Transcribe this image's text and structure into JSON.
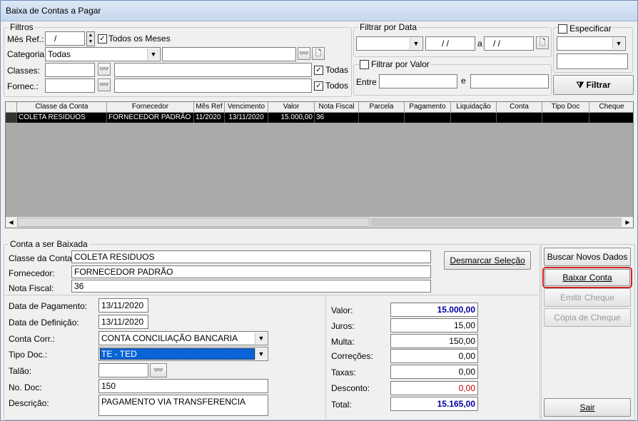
{
  "window": {
    "title": "Baixa de Contas a Pagar"
  },
  "filtros": {
    "legend": "Filtros",
    "mes_ref_label": "Mês Ref.:",
    "mes_ref_value": "/",
    "todos_meses_label": "Todos os Meses",
    "categoria_label": "Categoria:",
    "categoria_value": "Todas",
    "classes_label": "Classes:",
    "classes_todas_label": "Todas",
    "fornec_label": "Fornec.:",
    "fornec_todos_label": "Todos"
  },
  "filtrar_data": {
    "legend": "Filtrar por Data",
    "date_from": "/ /",
    "a_label": "a",
    "date_to": "/ /"
  },
  "filtrar_valor": {
    "legend": "Filtrar por Valor",
    "entre_label": "Entre",
    "e_label": "e"
  },
  "especificar": {
    "label": "Especificar"
  },
  "filtrar_button": "Filtrar",
  "grid": {
    "columns": [
      "Classe da Conta",
      "Fornecedor",
      "Mês Ref",
      "Vencimento",
      "Valor",
      "Nota Fiscal",
      "Parcela",
      "Pagamento",
      "Liquidação",
      "Conta",
      "Tipo Doc",
      "Cheque"
    ],
    "rows": [
      [
        "COLETA RESIDUOS",
        "FORNECEDOR PADRÃO",
        "11/2020",
        "13/11/2020",
        "15.000,00",
        "36",
        "",
        "",
        "",
        "",
        "",
        ""
      ]
    ]
  },
  "conta": {
    "legend": "Conta a ser Baixada",
    "classe_label": "Classe da Conta:",
    "classe_value": "COLETA RESIDUOS",
    "fornecedor_label": "Fornecedor:",
    "fornecedor_value": "FORNECEDOR PADRÃO",
    "nota_label": "Nota Fiscal:",
    "nota_value": "36",
    "desmarcar_button": "Desmarcar Seleção"
  },
  "pagamento": {
    "data_pag_label": "Data de Pagamento:",
    "data_pag_value": "13/11/2020",
    "data_def_label": "Data de Definição:",
    "data_def_value": "13/11/2020",
    "conta_corr_label": "Conta Corr.:",
    "conta_corr_value": "CONTA CONCILIAÇÃO BANCARIA",
    "tipo_doc_label": "Tipo Doc.:",
    "tipo_doc_value": "TE - TED",
    "talao_label": "Talão:",
    "no_doc_label": "No. Doc:",
    "no_doc_value": "150",
    "descricao_label": "Descrição:",
    "descricao_value": "PAGAMENTO VIA TRANSFERENCIA"
  },
  "valores": {
    "valor_label": "Valor:",
    "valor": "15.000,00",
    "juros_label": "Juros:",
    "juros": "15,00",
    "multa_label": "Multa:",
    "multa": "150,00",
    "correcoes_label": "Correções:",
    "correcoes": "0,00",
    "taxas_label": "Taxas:",
    "taxas": "0,00",
    "desconto_label": "Desconto:",
    "desconto": "0,00",
    "total_label": "Total:",
    "total": "15.165,00"
  },
  "actions": {
    "buscar": "Buscar Novos Dados",
    "baixar": "Baixar Conta",
    "emitir": "Emitir Cheque",
    "copia": "Cópia de Cheque",
    "sair": "Sair"
  },
  "colors": {
    "highlight_border": "#d02020",
    "total_blue": "#0000a0",
    "desconto_red": "#c00000",
    "selection_blue": "#0a64d8"
  }
}
